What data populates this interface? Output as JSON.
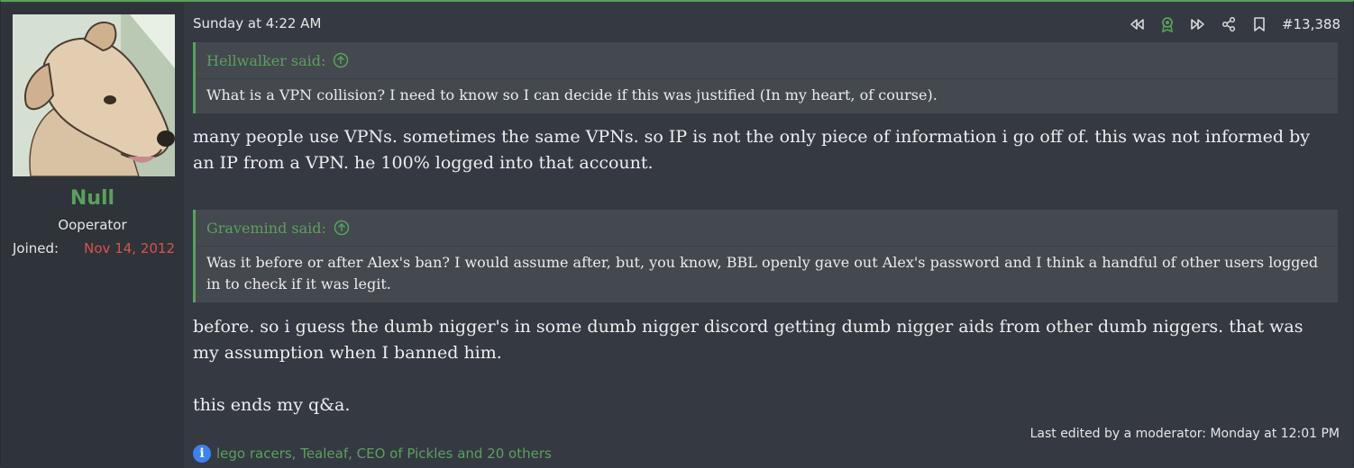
{
  "user": {
    "name": "Null",
    "title": "Ooperator",
    "joined_label": "Joined:",
    "joined_value": "Nov 14, 2012",
    "avatar_icon": "dog-avatar"
  },
  "post": {
    "date": "Sunday at 4:22 AM",
    "number": "#13,388",
    "actions": [
      "first-post-icon",
      "badge-icon",
      "last-post-icon",
      "share-icon",
      "bookmark-icon"
    ]
  },
  "quotes": [
    {
      "author": "Hellwalker said:",
      "text": "What is a VPN collision? I need to know so I can decide if this was justified (In my heart, of course)."
    },
    {
      "author": "Gravemind said:",
      "text": "Was it before or after Alex's ban? I would assume after, but, you know, BBL openly gave out Alex's password and I think a handful of other users logged in to check if it was legit."
    }
  ],
  "messages": {
    "reply1": "many people use VPNs. sometimes the same VPNs. so IP is not the only piece of information i go off of. this was not informed by an IP from a VPN. he 100% logged into that account.",
    "reply2": "before. so i guess the dumb nigger's in some dumb nigger discord getting dumb nigger aids from other dumb niggers. that was my assumption when I banned him.",
    "reply3": "this ends my q&a."
  },
  "edited": "Last edited by a moderator: Monday at 12:01 PM",
  "reactions": "lego racers, Tealeaf, CEO of Pickles and 20 others",
  "colors": {
    "accent": "#57a359",
    "background": "#353942",
    "joined_date": "#d9534f",
    "info_badge": "#3b82f0"
  }
}
